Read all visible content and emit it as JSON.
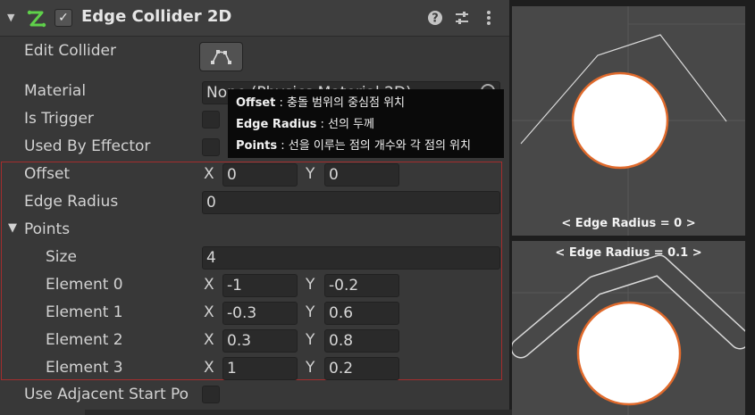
{
  "component": {
    "title": "Edge Collider 2D",
    "enabled_check": "✓",
    "fold_icon": "▼",
    "icons": [
      "edge-collider-icon",
      "help-icon",
      "presets-icon",
      "kebab-menu-icon"
    ]
  },
  "rows": {
    "edit_collider": "Edit Collider",
    "material": "Material",
    "material_value": "None (Physics Material 2D)",
    "is_trigger": "Is Trigger",
    "used_by_effector": "Used By Effector",
    "offset": "Offset",
    "offset_x": "0",
    "offset_y": "0",
    "edge_radius": "Edge Radius",
    "edge_radius_value": "0",
    "points": "Points",
    "points_fold": "▼",
    "size": "Size",
    "size_value": "4",
    "use_adjacent": "Use Adjacent Start Po"
  },
  "axis_x": "X",
  "axis_y": "Y",
  "elements": [
    {
      "label": "Element 0",
      "x": "-1",
      "y": "-0.2"
    },
    {
      "label": "Element 1",
      "x": "-0.3",
      "y": "0.6"
    },
    {
      "label": "Element 2",
      "x": "0.3",
      "y": "0.8"
    },
    {
      "label": "Element 3",
      "x": "1",
      "y": "0.2"
    }
  ],
  "tooltip": {
    "line1_key": "Offset",
    "line1_text": " : 충돌 범위의 중심점 위치",
    "line2_key": "Edge Radius",
    "line2_text": " : 선의 두께",
    "line3_key": "Points",
    "line3_text": " : 선을 이루는 점의 개수와 각 점의 위치"
  },
  "scene": {
    "caption_top": "< Edge Radius = 0 >",
    "caption_bottom": "< Edge Radius = 0.1 >",
    "circle_fill": "#ffffff",
    "circle_outline": "#e06a2c",
    "line_color": "#d9d9d9"
  },
  "colors": {
    "panel_bg": "#383838",
    "field_bg": "#2a2a2a",
    "highlight_border": "#a32d2d",
    "icon_green": "#5fd14a"
  }
}
